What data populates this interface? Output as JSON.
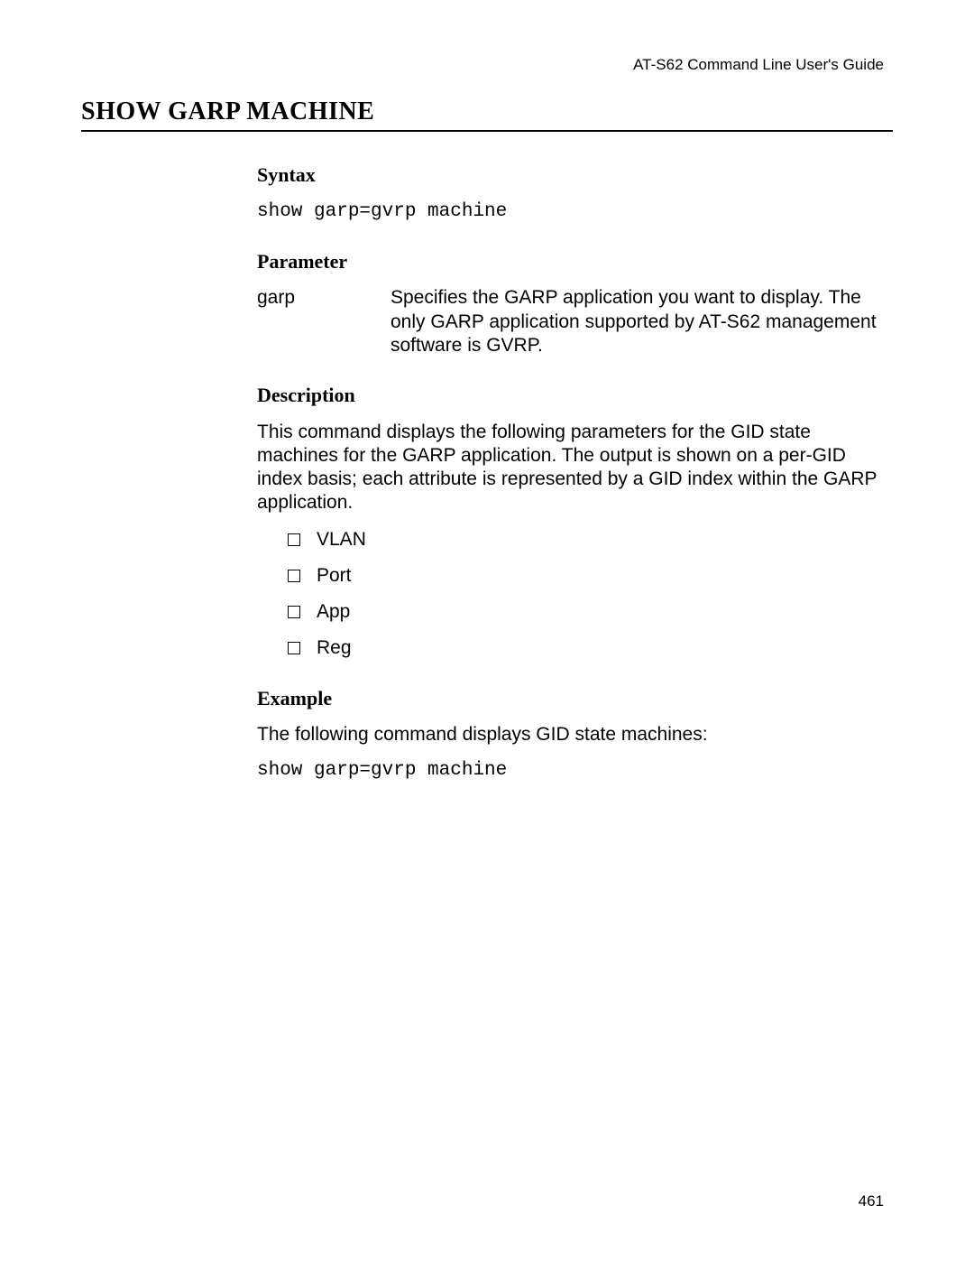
{
  "running_head": "AT-S62 Command Line User's Guide",
  "page_number": "461",
  "title": "SHOW GARP MACHINE",
  "sections": {
    "syntax": {
      "heading": "Syntax",
      "code": "show garp=gvrp machine"
    },
    "parameter": {
      "heading": "Parameter",
      "name": "garp",
      "desc": "Specifies the GARP application you want to display. The only GARP application supported by AT-S62 management software is GVRP."
    },
    "description": {
      "heading": "Description",
      "text": "This command displays the following parameters for the GID state machines for the GARP application. The output is shown on a per-GID index basis; each attribute is represented by a GID index within the GARP application.",
      "bullets": [
        "VLAN",
        "Port",
        "App",
        "Reg"
      ]
    },
    "example": {
      "heading": "Example",
      "text": "The following command displays GID state machines:",
      "code": "show garp=gvrp machine"
    }
  }
}
